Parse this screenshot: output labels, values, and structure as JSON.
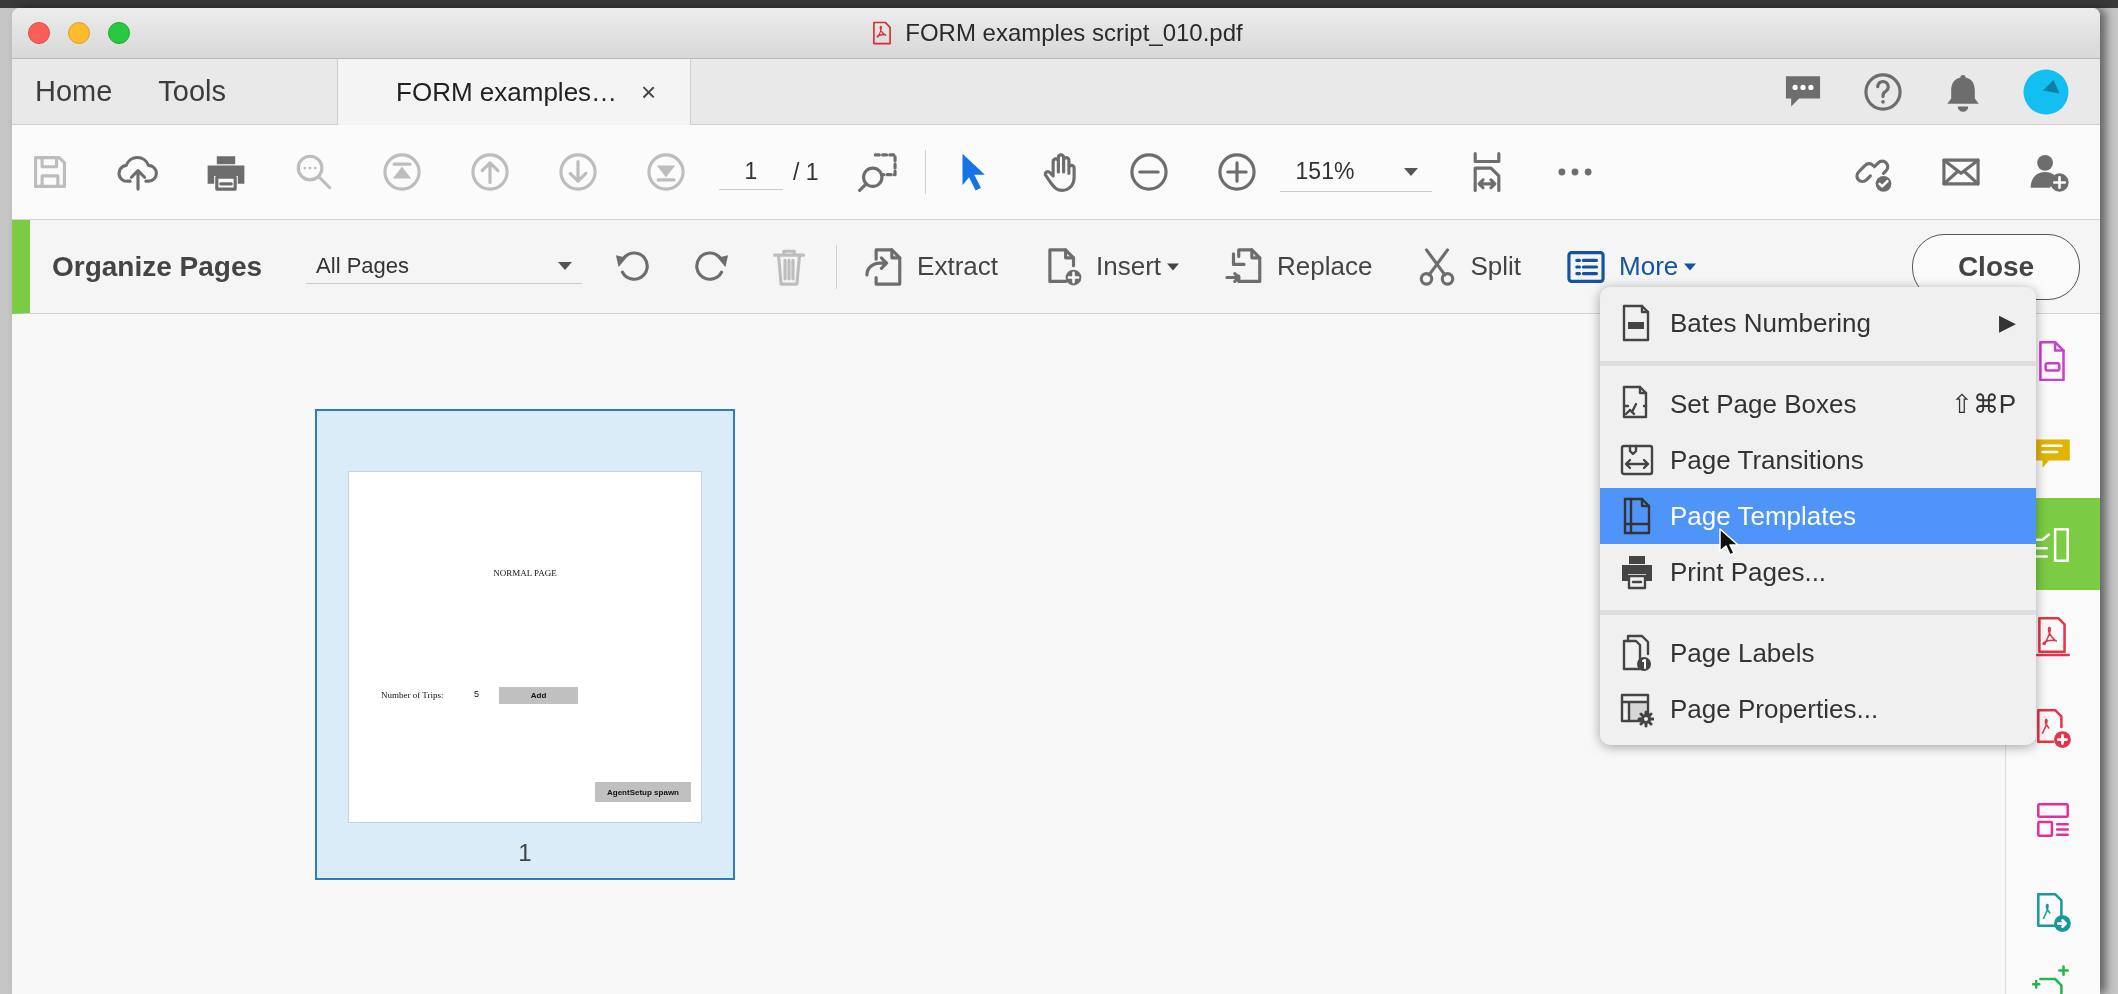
{
  "window": {
    "title": "FORM examples script_010.pdf"
  },
  "nav_tabs": [
    {
      "label": "Home",
      "selected": false
    },
    {
      "label": "Tools",
      "selected": false
    }
  ],
  "document_tab": {
    "label": "FORM examples…",
    "close": "×",
    "selected": true
  },
  "toolbar": {
    "buttons": [
      {
        "disabled": true
      },
      {
        "disabled": false
      },
      {
        "disabled": false
      },
      {
        "disabled": true
      },
      {
        "disabled": true
      },
      {
        "disabled": true
      },
      {
        "disabled": true
      },
      {
        "disabled": true
      }
    ],
    "page_number": "1",
    "page_count": "/ 1",
    "tools": [
      {
        "selected": true
      },
      {
        "selected": false
      }
    ],
    "zoom": "151%"
  },
  "organize_bar": {
    "title": "Organize Pages",
    "page_range": "All Pages",
    "actions": [
      {
        "disabled": false
      },
      {
        "disabled": false
      },
      {
        "disabled": true
      }
    ],
    "tools": [
      {
        "label": "Extract",
        "dropdown": false,
        "expanded": false
      },
      {
        "label": "Insert",
        "dropdown": true,
        "expanded": false
      },
      {
        "label": "Replace",
        "dropdown": false,
        "expanded": false
      },
      {
        "label": "Split",
        "dropdown": false,
        "expanded": false
      },
      {
        "label": "More",
        "dropdown": true,
        "expanded": true
      }
    ],
    "close": "Close"
  },
  "thumbnails": [
    {
      "page_label": "1",
      "selected": true,
      "title": "NORMAL PAGE",
      "field_label": "Number of Trips:",
      "field_value": "5",
      "buttons": [
        "Add",
        "AgentSetup spawn"
      ]
    }
  ],
  "menu": {
    "groups": [
      [
        {
          "label": "Bates Numbering",
          "arrow": "▶",
          "selected": false
        }
      ],
      [
        {
          "label": "Set Page Boxes",
          "shortcut": "⇧⌘P",
          "selected": false
        },
        {
          "label": "Page Transitions",
          "selected": false
        },
        {
          "label": "Page Templates",
          "selected": true
        },
        {
          "label": "Print Pages...",
          "selected": false
        }
      ],
      [
        {
          "label": "Page Labels",
          "selected": false
        },
        {
          "label": "Page Properties...",
          "selected": false
        }
      ]
    ]
  },
  "right_rail": {
    "items": [
      {
        "color": "#cc3fcc",
        "selected": false
      },
      {
        "color": "#e0b400",
        "selected": false
      },
      {
        "color": "#7ccb44",
        "selected": true
      },
      {
        "color": "#e3344a",
        "selected": false
      },
      {
        "color": "#e3344a",
        "selected": false
      },
      {
        "color": "#e0309a",
        "selected": false
      },
      {
        "color": "#17999a",
        "selected": false
      },
      {
        "color": "#2bb24c",
        "selected": false
      }
    ]
  }
}
